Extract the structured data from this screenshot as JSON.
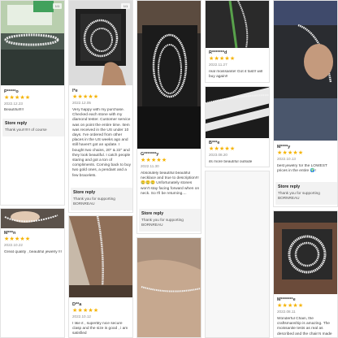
{
  "colors": {
    "star": "#f5b301",
    "reply_bg": "#f2f2f2",
    "border": "#e3e3e3"
  },
  "reply_title": "Store reply",
  "reviews": [
    {
      "name": "P*****o",
      "stars": "★★★★★",
      "date": "2022.12.23",
      "text": "Beautiful!!!!",
      "reply": "Thank you!!!!!!! of course"
    },
    {
      "name": "I*e",
      "stars": "★★★★★",
      "date": "2022.12.05",
      "text": "Very happy with my purchase. Checked each stone with my diamond tester. Customer service was on point the entire time. Item was received in the US under 10 days. I've ordered from other places in the US weeks ago and still haven't got an update. I bought two chains, 20\" & 22\" and they look beautiful. I catch people staring and got a ton of compliments. Coming back to buy two gold ones, a pendant and a few bracelets.",
      "reply": "Thank you for supporting BORNREAU"
    },
    {
      "name": "G*******y",
      "stars": "★★★★★",
      "date": "2022.11.30",
      "text": "Absolutely beautiful beautiful necklace and true to description!!! 🥲🥲🥲 Unfortunately stones won't stay facing forward when on neck. So I'll be returning....",
      "reply": "Thank you for supporting BORNREAU"
    },
    {
      "name": "R*******d",
      "stars": "★★★★★",
      "date": "2022.11.27",
      "text": "real moissanite! Got it fast!! will buy again!!",
      "reply": ""
    },
    {
      "name": "B***e",
      "stars": "★★★★★",
      "date": "2023.08.20",
      "text": "its more beautiful outside",
      "reply": ""
    },
    {
      "name": "M****y",
      "stars": "★★★★★",
      "date": "2022.10.13",
      "text": "best jewelry for the LOWEST prices in the entire 🌍!",
      "reply": "Thank you for supporting BORNREAU"
    },
    {
      "name": "M***n",
      "stars": "★★★★★",
      "date": "2022.10.22",
      "text": "Great quality , beautiful jewelry !!!",
      "reply": ""
    },
    {
      "name": "D**a",
      "stars": "★★★★★",
      "date": "2022.10.12",
      "text": "I like it , superbly nice secure clasp and the size is good , i am satisfied",
      "reply": ""
    },
    {
      "name": "M*******e",
      "stars": "★★★★★",
      "date": "2022.08.11",
      "text": "Wonderful Chain, the craftsmanship is amazing. The moissanite tests as real as described and the chain's made",
      "reply": ""
    }
  ],
  "badge_label": "1/1"
}
